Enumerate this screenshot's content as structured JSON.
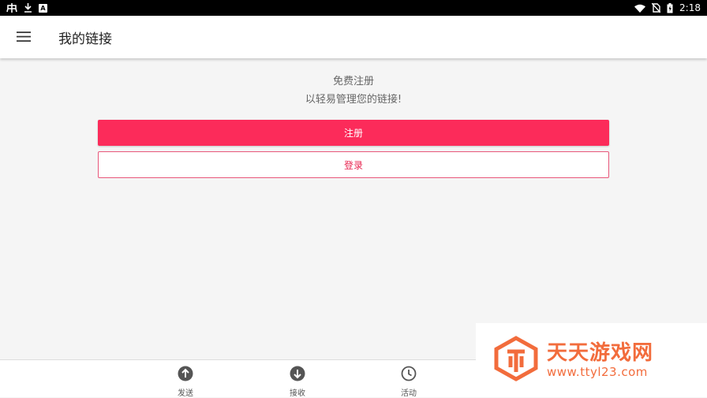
{
  "status_bar": {
    "time": "2:18",
    "left_icons": [
      "carrier-glyph-icon",
      "download-icon",
      "a-badge-icon"
    ],
    "right_icons": [
      "wifi-icon",
      "no-sim-icon",
      "battery-charging-icon"
    ]
  },
  "app_bar": {
    "menu_icon": "hamburger-menu-icon",
    "title": "我的链接"
  },
  "main": {
    "promo_line1": "免费注册",
    "promo_line2": "以轻易管理您的链接!",
    "register_label": "注册",
    "login_label": "登录"
  },
  "bottom_nav": {
    "items": [
      {
        "label": "发送",
        "icon": "arrow-up-circle-icon"
      },
      {
        "label": "接收",
        "icon": "arrow-down-circle-icon"
      },
      {
        "label": "活动",
        "icon": "clock-icon"
      }
    ]
  },
  "watermark": {
    "name": "天天游戏网",
    "url": "www.ttyl23.com"
  },
  "colors": {
    "accent": "#fc2b5a",
    "watermark": "#f26c3c"
  }
}
